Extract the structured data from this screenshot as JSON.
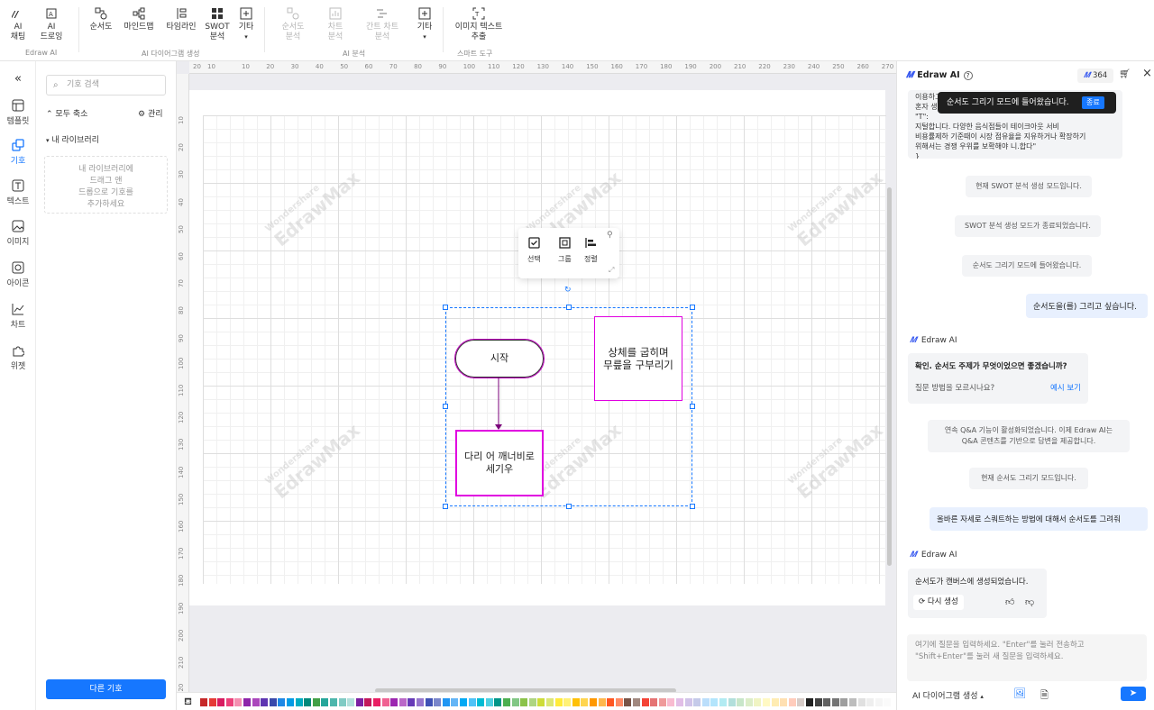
{
  "ribbon": {
    "groups": [
      {
        "label": "Edraw AI",
        "buttons": [
          {
            "label": "AI\n채팅"
          },
          {
            "label": "AI\n드로잉"
          }
        ]
      },
      {
        "label": "AI 다이어그램 생성",
        "buttons": [
          {
            "label": "순서도"
          },
          {
            "label": "마인드맵"
          },
          {
            "label": "타임라인"
          },
          {
            "label": "SWOT\n분석"
          },
          {
            "label": "기타"
          }
        ]
      },
      {
        "label": "AI 분석",
        "buttons": [
          {
            "label": "순서도\n분석"
          },
          {
            "label": "차트\n분석"
          },
          {
            "label": "간트 차트\n분석"
          },
          {
            "label": "기타"
          }
        ]
      },
      {
        "label": "스마트 도구",
        "buttons": [
          {
            "label": "이미지 텍스트\n추출"
          }
        ]
      }
    ]
  },
  "rail": {
    "items": [
      {
        "label": "템플릿"
      },
      {
        "label": "기호"
      },
      {
        "label": "텍스트"
      },
      {
        "label": "이미지"
      },
      {
        "label": "아이콘"
      },
      {
        "label": "차트"
      },
      {
        "label": "위젯"
      }
    ]
  },
  "library": {
    "search_placeholder": "기호 검색",
    "collapse_all": "모두 축소",
    "manage": "관리",
    "my_library": "내 라이브러리",
    "drop_hint": "내 라이브러리에\n드래그 앤\n드롭으로 기호를\n추가하세요",
    "more_symbols": "다른 기호"
  },
  "ruler": {
    "top": [
      "10",
      "20",
      "30",
      "40",
      "50",
      "60",
      "70",
      "80",
      "90",
      "100",
      "110",
      "120",
      "130",
      "140",
      "150",
      "160",
      "170",
      "180",
      "190",
      "200",
      "210",
      "220",
      "230",
      "240",
      "250",
      "260",
      "270",
      "280"
    ],
    "top_neg": [
      "20",
      "10"
    ],
    "left": [
      "10",
      "20",
      "30",
      "40",
      "50",
      "60",
      "70",
      "80",
      "90",
      "100",
      "110",
      "120",
      "130",
      "140",
      "150",
      "160",
      "170",
      "180",
      "190",
      "200",
      "210",
      "220"
    ]
  },
  "watermark": {
    "brand": "EdrawMax",
    "company": "Wondershare"
  },
  "float_toolbar": {
    "select": "선택",
    "group": "그룹",
    "align": "정렬"
  },
  "shapes": {
    "start": "시작",
    "step1": "다리 어 깨너비로\n세기우",
    "step2": "상체를 굽히며\n무릎을 구부리기"
  },
  "chat": {
    "title": "Edraw AI",
    "credits": "364",
    "toast_text": "순서도 그리기 모드에 들어왔습니다.",
    "toast_button": "종료",
    "top_partial": "이용하고 있습니다. 특히, 언내믄들의 바른 생활방식과\n혼자 생\n\"T\":\n지털합니다. 다양한 음식점들이 테이크아웃 서비\n비용률제하 기준때이 시장 점유율을 지유하거나 확장하기\n위해서는 경쟁 우위를 보확해야 니.합다\"\n}",
    "sys1": "현재 SWOT 분석 생성 모드입니다.",
    "sys2": "SWOT 분석 생성 모드가 종료되었습니다.",
    "sys3": "순서도 그리기 모드에 들어왔습니다.",
    "user1": "순서도을(를) 그리고 싶습니다.",
    "ai_name": "Edraw AI",
    "ai1_question": "확인. 순서도 주제가 무엇이었으면 좋겠습니까?",
    "ai1_hint": "질문 방법을 모르시나요?",
    "ai1_link": "예시 보기",
    "sys4": "연속 Q&A 기능이 활성화되었습니다. 이제 Edraw AI는\nQ&A 콘텐츠를 기반으로 답변을 제공합니다.",
    "sys5": "현재 순서도 그리기 모드입니다.",
    "user2": "올바른 자세로 스쿼트하는 방법에 대해서 순서도를 그려줘",
    "ai2_text": "순서도가 캔버스에 생성되었습니다.",
    "regenerate": "다시 생성",
    "input_placeholder": "여기에 질문을 입력하세요. \"Enter\"를 눌러 전송하고\n\"Shift+Enter\"를 눌러 새 질문을 입력하세요.",
    "mode_select": "AI 다이어그램 생성"
  },
  "colors": {
    "accent": "#1677ff",
    "shape_border": "#c000c0",
    "palette": [
      "#c62828",
      "#e53935",
      "#d81b60",
      "#ec407a",
      "#f48fb1",
      "#8e24aa",
      "#ab47bc",
      "#5e35b1",
      "#3949ab",
      "#1e88e5",
      "#039be5",
      "#00acc1",
      "#00897b",
      "#43a047",
      "#26a69a",
      "#4db6ac",
      "#80cbc4",
      "#b2dfdb",
      "#7b1fa2",
      "#c2185b",
      "#e91e63",
      "#f06292",
      "#9c27b0",
      "#ba68c8",
      "#673ab7",
      "#9575cd",
      "#3f51b5",
      "#7986cb",
      "#2196f3",
      "#64b5f6",
      "#03a9f4",
      "#4fc3f7",
      "#00bcd4",
      "#4dd0e1",
      "#009688",
      "#4caf50",
      "#81c784",
      "#8bc34a",
      "#aed581",
      "#cddc39",
      "#dce775",
      "#ffeb3b",
      "#fff176",
      "#ffc107",
      "#ffd54f",
      "#ff9800",
      "#ffb74d",
      "#ff5722",
      "#ff8a65",
      "#795548",
      "#a1887f",
      "#f44336",
      "#e57373",
      "#ef9a9a",
      "#f8bbd0",
      "#e1bee7",
      "#d1c4e9",
      "#c5cae9",
      "#bbdefb",
      "#b3e5fc",
      "#b2ebf2",
      "#b2dfdb",
      "#c8e6c9",
      "#dcedc8",
      "#f0f4c3",
      "#fff9c4",
      "#ffecb3",
      "#ffe0b2",
      "#ffccbc",
      "#d7ccc8",
      "#212121",
      "#424242",
      "#616161",
      "#757575",
      "#9e9e9e",
      "#bdbdbd",
      "#e0e0e0",
      "#eeeeee",
      "#f5f5f5",
      "#fafafa"
    ]
  }
}
